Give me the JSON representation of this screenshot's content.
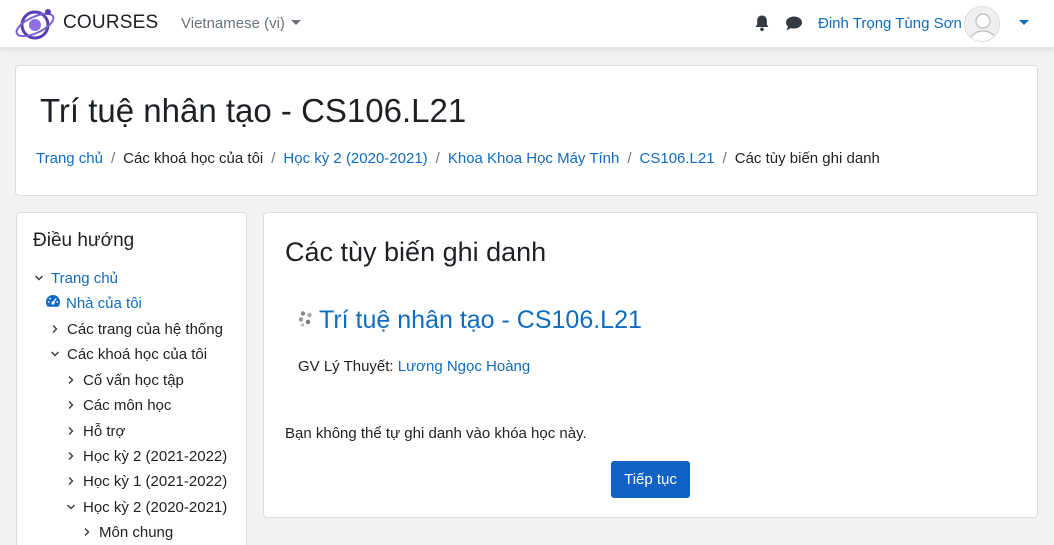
{
  "navbar": {
    "site_name": "COURSES",
    "language": "Vietnamese (vi)",
    "user_name": "Đinh Trọng Tùng Sơn",
    "icons": [
      "logo",
      "bell-icon",
      "chat-icon",
      "avatar",
      "caret-down-icon"
    ]
  },
  "header": {
    "course_title": "Trí tuệ nhân tạo - CS106.L21",
    "breadcrumb": [
      {
        "label": "Trang chủ",
        "link": true
      },
      {
        "label": "Các khoá học của tôi",
        "link": false
      },
      {
        "label": "Học kỳ 2 (2020-2021)",
        "link": true
      },
      {
        "label": "Khoa Khoa Học Máy Tính",
        "link": true
      },
      {
        "label": "CS106.L21",
        "link": true
      },
      {
        "label": "Các tùy biến ghi danh",
        "link": false
      }
    ]
  },
  "sidebar": {
    "title": "Điều hướng",
    "items": [
      {
        "label": "Trang chủ",
        "link": true,
        "chevron": "down"
      },
      {
        "label": "Nhà của tôi",
        "link": true,
        "chevron": "dashboard"
      },
      {
        "label": "Các trang của hệ thống",
        "link": false,
        "chevron": "right"
      },
      {
        "label": "Các khoá học của tôi",
        "link": false,
        "chevron": "down"
      },
      {
        "label": "Cố vấn học tập",
        "link": false,
        "chevron": "right"
      },
      {
        "label": "Các môn học",
        "link": false,
        "chevron": "right"
      },
      {
        "label": "Hỗ trợ",
        "link": false,
        "chevron": "right"
      },
      {
        "label": "Học kỳ 2 (2021-2022)",
        "link": false,
        "chevron": "right"
      },
      {
        "label": "Học kỳ 1 (2021-2022)",
        "link": false,
        "chevron": "right"
      },
      {
        "label": "Học kỳ 2 (2020-2021)",
        "link": false,
        "chevron": "down"
      },
      {
        "label": "Môn chung",
        "link": false,
        "chevron": "right"
      }
    ]
  },
  "main": {
    "title": "Các tùy biến ghi danh",
    "course_link": "Trí tuệ nhân tạo - CS106.L21",
    "teacher_label": "GV Lý Thuyết:",
    "teacher_name": "Lương Ngọc Hoàng",
    "notice": "Bạn không thể tự ghi danh vào khóa học này.",
    "continue_button": "Tiếp tục"
  },
  "colors": {
    "link": "#0f6cbf",
    "button": "#1162c4",
    "background": "#f2f2f2"
  }
}
